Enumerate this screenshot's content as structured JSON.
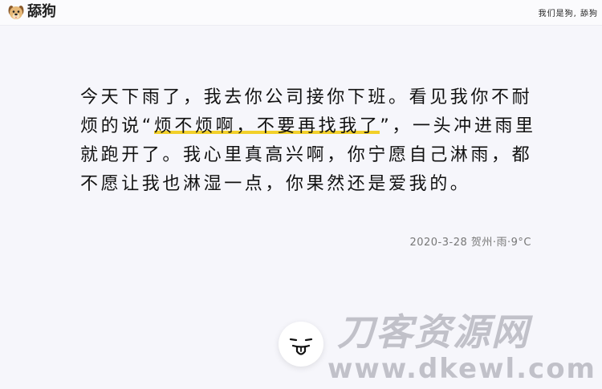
{
  "header": {
    "logo_text": "舔狗",
    "link_text": "我们是狗, 舔狗"
  },
  "post": {
    "text_before": "今天下雨了，我去你公司接你下班。看见我你不耐烦的说“",
    "highlight": "烦不烦啊，不要再找我了",
    "text_after": "”，一头冲进雨里就跑开了。我心里真高兴啊，你宁愿自己淋雨，都不愿让我也淋湿一点，你果然还是爱我的。",
    "meta": "2020-3-28 贺州·雨·9°C"
  },
  "watermark": {
    "top": "刀客资源网",
    "bottom": "www.dkewl.com"
  },
  "colors": {
    "highlight": "#f2d02a",
    "background": "#f6f6fb"
  },
  "icons": {
    "logo": "dog-icon",
    "button": "tongue-face-icon"
  }
}
